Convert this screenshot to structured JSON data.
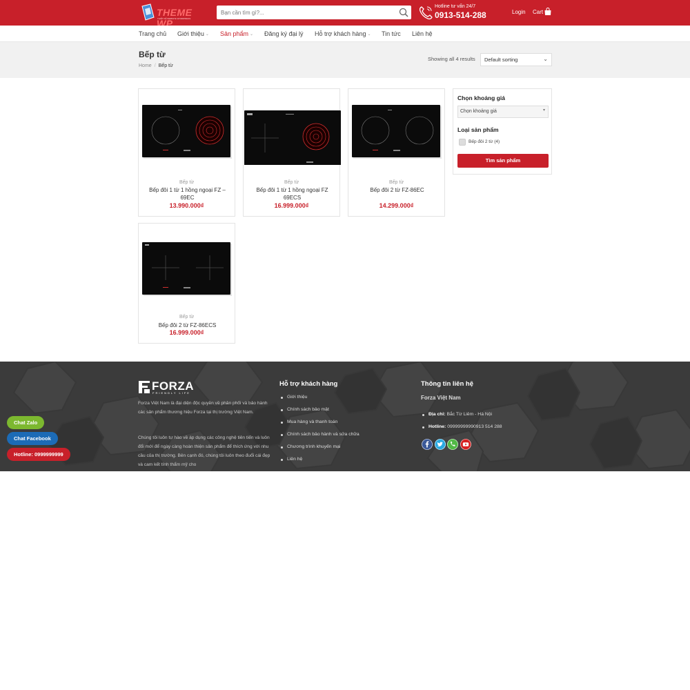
{
  "header": {
    "logo_text": "THEME WP",
    "logo_sub": "THIẾT KẾ WEBSITE WORDPRESS",
    "search_placeholder": "Bạn cần tìm gì?...",
    "hotline_label": "Hotline tư vấn 24/7",
    "hotline_number": "0913-514-288",
    "login_label": "Login",
    "cart_label": "Cart",
    "colors": {
      "primary": "#c8202a"
    }
  },
  "nav": {
    "items": [
      {
        "label": "Trang chủ",
        "dropdown": false,
        "active": false
      },
      {
        "label": "Giới thiệu",
        "dropdown": true,
        "active": false
      },
      {
        "label": "Sản phẩm",
        "dropdown": true,
        "active": true
      },
      {
        "label": "Đăng ký đại lý",
        "dropdown": false,
        "active": false
      },
      {
        "label": "Hỗ trợ khách hàng",
        "dropdown": true,
        "active": false
      },
      {
        "label": "Tin tức",
        "dropdown": false,
        "active": false
      },
      {
        "label": "Liên hệ",
        "dropdown": false,
        "active": false
      }
    ]
  },
  "page": {
    "title": "Bếp từ",
    "breadcrumb": {
      "home": "Home",
      "separator": "/",
      "current": "Bếp từ"
    },
    "results": "Showing all 4 results",
    "sorting": "Default sorting"
  },
  "products": [
    {
      "category": "Bếp từ",
      "name": "Bếp đôi 1 từ 1 hồng ngoại FZ – 69EC",
      "price": "13.990.000₫"
    },
    {
      "category": "Bếp từ",
      "name": "Bếp đôi 1 từ 1 hồng ngoại FZ 69ECS",
      "price": "16.999.000₫"
    },
    {
      "category": "Bếp từ",
      "name": "Bếp đôi 2 từ FZ-86EC",
      "price": "14.299.000₫"
    },
    {
      "category": "Bếp từ",
      "name": "Bếp đôi 2 từ FZ-86ECS",
      "price": "16.999.000₫"
    }
  ],
  "filter": {
    "price_title": "Chọn khoảng giá",
    "price_select": "Chọn khoảng giá",
    "type_title": "Loại sản phẩm",
    "type_option": "Bếp đôi 2 từ (4)",
    "button": "Tìm sản phẩm"
  },
  "footer": {
    "brand": "FORZA",
    "brand_sub": "FRIENDLY LIFE",
    "about_1": "Forza Việt Nam là đại diện độc quyền về phân phối và bảo hành các sản phẩm thương hiệu Forza tại thị trường Việt Nam.",
    "about_2": "Chúng tôi luôn tự hào về áp dụng các công nghệ tiên tiến và luôn đổi mới để ngày càng hoàn thiện sản phẩm để thích ứng với nhu cầu của thị trường. Bên cạnh đó, chúng tôi luôn theo đuổi cái đẹp và cam kết tính thẩm mỹ cho",
    "support_title": "Hỗ trợ khách hàng",
    "support_links": [
      "Giới thiệu",
      "Chính sách bảo mật",
      "Mua hàng và thanh toán",
      "Chính sách bảo hành và sửa chữa",
      "Chương trình khuyến mại",
      "Liên hệ"
    ],
    "contact_title": "Thông tin liên hệ",
    "company": "Forza Việt Nam",
    "address_label": "Địa chỉ:",
    "address": "Bắc Từ Liêm - Hà Nội",
    "hotline_label": "Hotline:",
    "hotline": "09999999990913 514 288",
    "social": [
      {
        "icon": "facebook-icon",
        "color": "#3b5998"
      },
      {
        "icon": "twitter-icon",
        "color": "#2aa9e0"
      },
      {
        "icon": "phone-icon",
        "color": "#51b846"
      },
      {
        "icon": "youtube-icon",
        "color": "#d62020"
      }
    ]
  },
  "floating": {
    "zalo": "Chat Zalo",
    "facebook": "Chat Facebook",
    "hotline": "Hotline: 0999999999",
    "colors": {
      "zalo": "#7cb82f",
      "facebook": "#1c6bb6",
      "hotline": "#c8202a"
    }
  }
}
